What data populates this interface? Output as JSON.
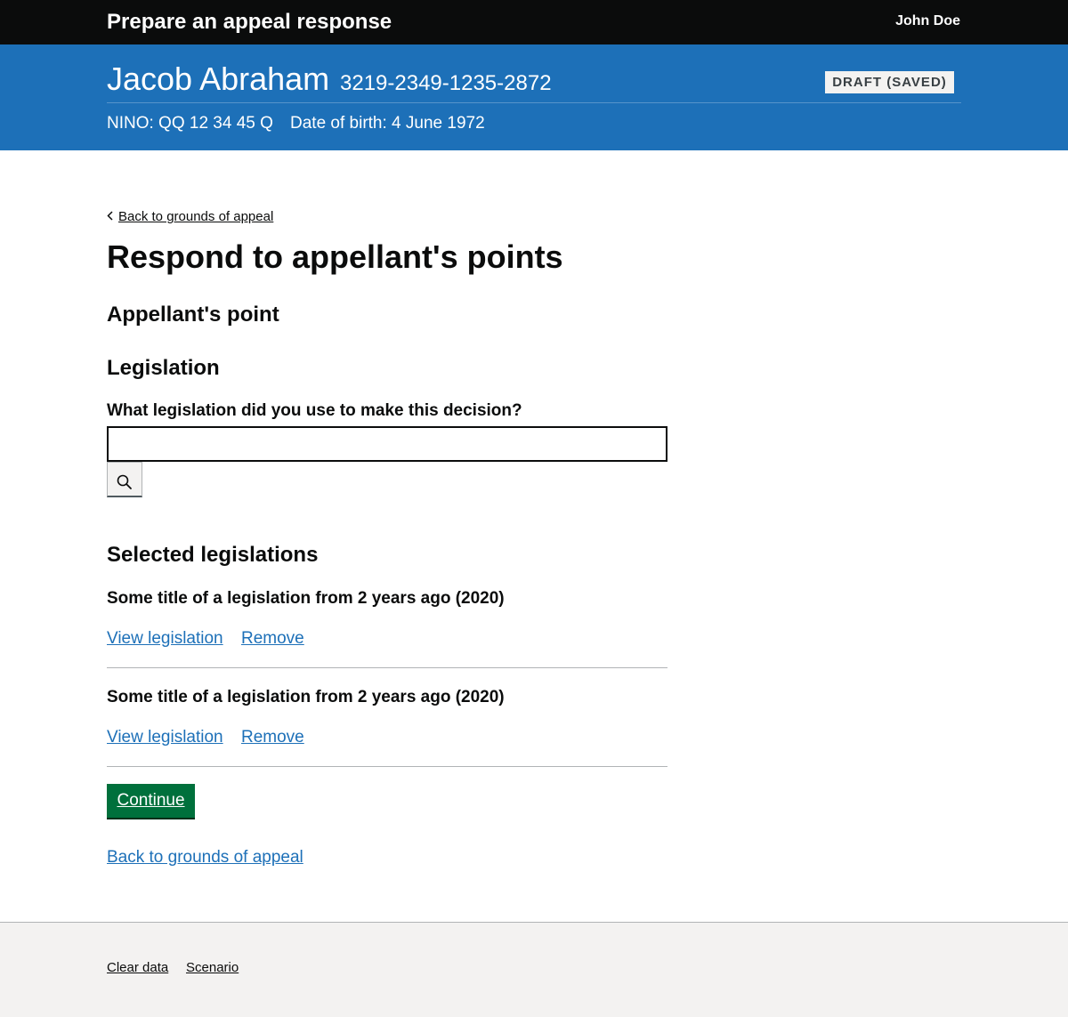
{
  "header": {
    "service_name": "Prepare an appeal response",
    "user_name": "John Doe"
  },
  "banner": {
    "person_name": "Jacob Abraham",
    "case_reference": "3219-2349-1235-2872",
    "status": "DRAFT (SAVED)",
    "nino": "NINO: QQ 12 34 45 Q",
    "date_of_birth": "Date of birth: 4 June 1972"
  },
  "navigation": {
    "back_link_top": "Back to grounds of appeal",
    "back_link_bottom": "Back to grounds of appeal"
  },
  "main": {
    "page_title": "Respond to appellant's points",
    "appellant_point_heading": "Appellant's point",
    "legislation_heading": "Legislation",
    "legislation_question": "What legislation did you use to make this decision?",
    "search_value": "",
    "search_icon": "search-icon",
    "selected_heading": "Selected legislations",
    "selected_legislations": [
      {
        "title": "Some title of a legislation from 2 years ago (2020)",
        "view_label": "View legislation",
        "remove_label": "Remove"
      },
      {
        "title": "Some title of a legislation from 2 years ago (2020)",
        "view_label": "View legislation",
        "remove_label": "Remove"
      }
    ],
    "continue_label": "Continue"
  },
  "footer": {
    "links": [
      "Clear data",
      "Scenario"
    ]
  },
  "colors": {
    "header_bg": "#0b0c0c",
    "banner_bg": "#1d70b8",
    "link": "#1d70b8",
    "button_green": "#00703c",
    "footer_bg": "#f3f2f1",
    "tag_bg": "#f3f2f1"
  }
}
